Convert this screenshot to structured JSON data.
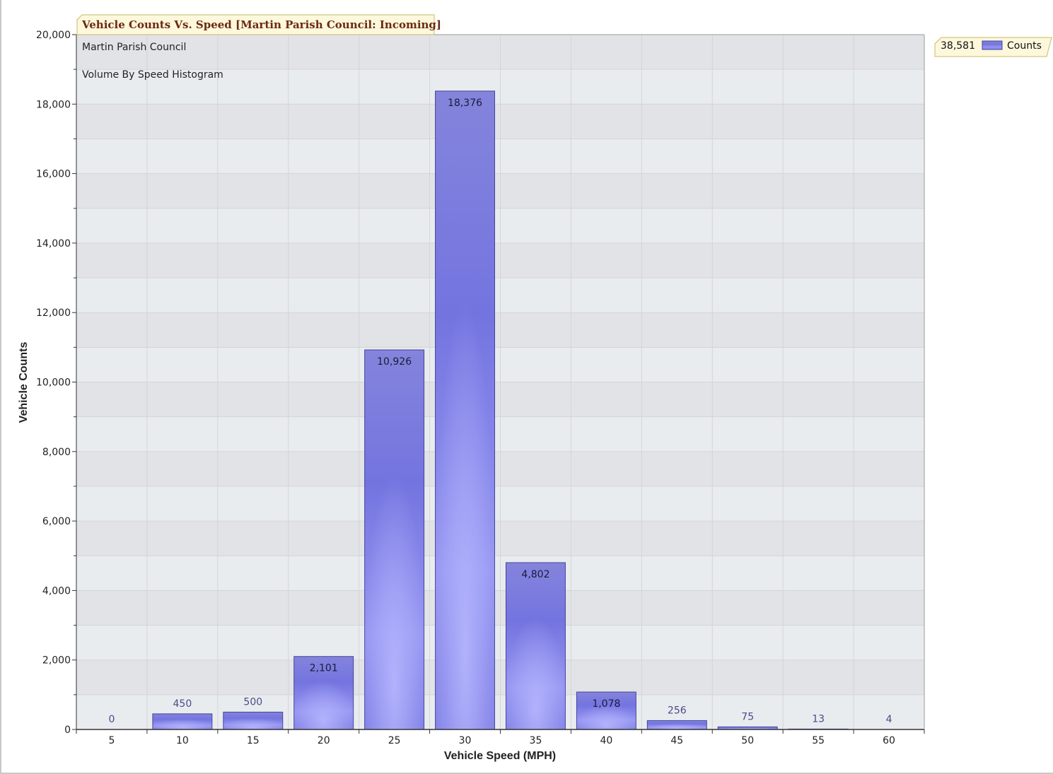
{
  "chart_data": {
    "type": "bar",
    "title": "Vehicle Counts Vs. Speed [Martin Parish Council: Incoming]",
    "annotations": [
      "Martin Parish Council",
      "Volume By Speed Histogram"
    ],
    "xlabel": "Vehicle Speed (MPH)",
    "ylabel": "Vehicle Counts",
    "categories": [
      "5",
      "10",
      "15",
      "20",
      "25",
      "30",
      "35",
      "40",
      "45",
      "50",
      "55",
      "60"
    ],
    "series": [
      {
        "name": "Counts",
        "values": [
          0,
          450,
          500,
          2101,
          10926,
          18376,
          4802,
          1078,
          256,
          75,
          13,
          4
        ],
        "labels": [
          "0",
          "450",
          "500",
          "2,101",
          "10,926",
          "18,376",
          "4,802",
          "1,078",
          "256",
          "75",
          "13",
          "4"
        ],
        "color": "#7b7be6"
      }
    ],
    "ylim": [
      0,
      20000
    ],
    "y_major_ticks": [
      0,
      2000,
      4000,
      6000,
      8000,
      10000,
      12000,
      14000,
      16000,
      18000,
      20000
    ],
    "y_tick_labels": [
      "0",
      "2,000",
      "4,000",
      "6,000",
      "8,000",
      "10,000",
      "12,000",
      "14,000",
      "16,000",
      "18,000",
      "20,000"
    ],
    "y_minor_step": 1000,
    "grid": true,
    "legend": {
      "position": "top-right",
      "total": "38,581",
      "label": "Counts"
    },
    "colors": {
      "band_light": "#e9ecef",
      "band_dark": "#e2e3e6",
      "grid": "#d4d4d8",
      "bar_edge": "#44449a",
      "label_inside": "#1a1a3a",
      "label_above": "#4a4a8a",
      "title_fill": "#fdf8dc",
      "title_border": "#c9b86a"
    }
  }
}
